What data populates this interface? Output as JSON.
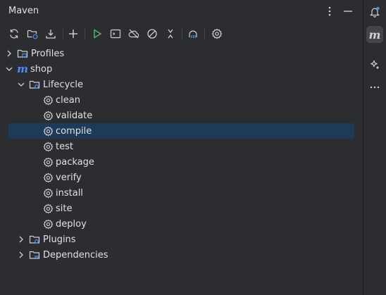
{
  "panel": {
    "title": "Maven"
  },
  "header": {
    "more_icon": "more-vertical-icon",
    "hide_icon": "minimize-icon"
  },
  "toolbar": {
    "buttons": [
      {
        "name": "reload-all-button",
        "icon": "refresh-icon"
      },
      {
        "name": "generate-sources-button",
        "icon": "folder-sync-icon"
      },
      {
        "name": "download-sources-button",
        "icon": "download-icon"
      },
      {
        "name": "add-project-button",
        "icon": "plus-icon"
      },
      {
        "name": "run-button",
        "icon": "run-icon",
        "color": "#5fb865"
      },
      {
        "name": "execute-goal-button",
        "icon": "terminal-icon"
      },
      {
        "name": "toggle-offline-button",
        "icon": "cloud-off-icon"
      },
      {
        "name": "skip-tests-button",
        "icon": "circle-slash-icon"
      },
      {
        "name": "collapse-all-button",
        "icon": "collapse-icon"
      },
      {
        "name": "show-dependencies-button",
        "icon": "dependencies-icon"
      },
      {
        "name": "settings-button",
        "icon": "gear-icon"
      }
    ]
  },
  "tree": {
    "profiles": "Profiles",
    "project": "shop",
    "lifecycle": "Lifecycle",
    "goals": [
      "clean",
      "validate",
      "compile",
      "test",
      "package",
      "verify",
      "install",
      "site",
      "deploy"
    ],
    "selected_goal": "compile",
    "plugins": "Plugins",
    "dependencies": "Dependencies"
  },
  "right_bar": {
    "notifications_icon": "bell-icon",
    "maven_icon_letter": "m",
    "ai_icon": "sparkle-icon",
    "more_icon": "ellipsis-icon"
  },
  "colors": {
    "accent": "#548af7",
    "selection": "#1f3a56",
    "run": "#5fb865",
    "notification_dot": "#548af7"
  }
}
